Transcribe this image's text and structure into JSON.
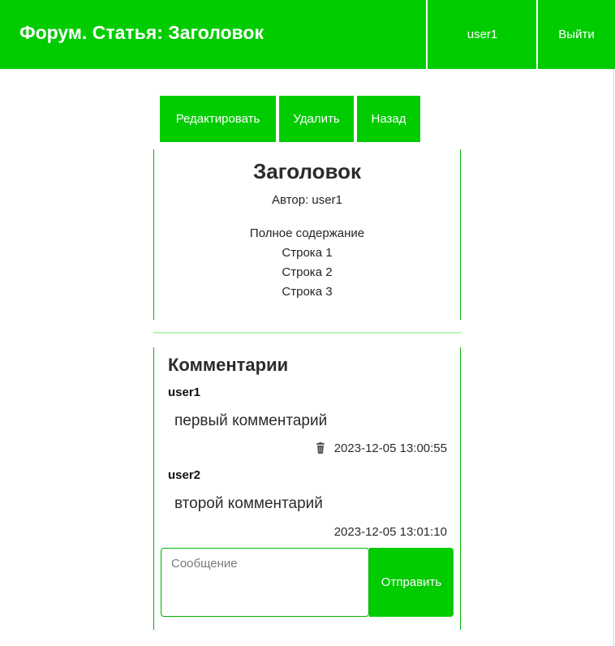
{
  "header": {
    "title": "Форум. Статья: Заголовок",
    "user_label": "user1",
    "logout_label": "Выйти"
  },
  "actions": {
    "edit_label": "Редактировать",
    "delete_label": "Удалить",
    "back_label": "Назад"
  },
  "article": {
    "title": "Заголовок",
    "author": "Автор: user1",
    "body_lines": [
      "Полное содержание",
      "Строка 1",
      "Строка 2",
      "Строка 3"
    ]
  },
  "comments": {
    "heading": "Комментарии",
    "items": [
      {
        "author": "user1",
        "text": "первый комментарий",
        "timestamp": "2023-12-05 13:00:55",
        "icon": "trash-icon"
      },
      {
        "author": "user2",
        "text": "второй комментарий",
        "timestamp": "2023-12-05 13:01:10"
      }
    ],
    "form": {
      "placeholder": "Сообщение",
      "value": "",
      "submit_label": "Отправить"
    }
  },
  "colors": {
    "accent": "#00cc00",
    "border": "#00b300",
    "divider": "#b9f2b9"
  }
}
